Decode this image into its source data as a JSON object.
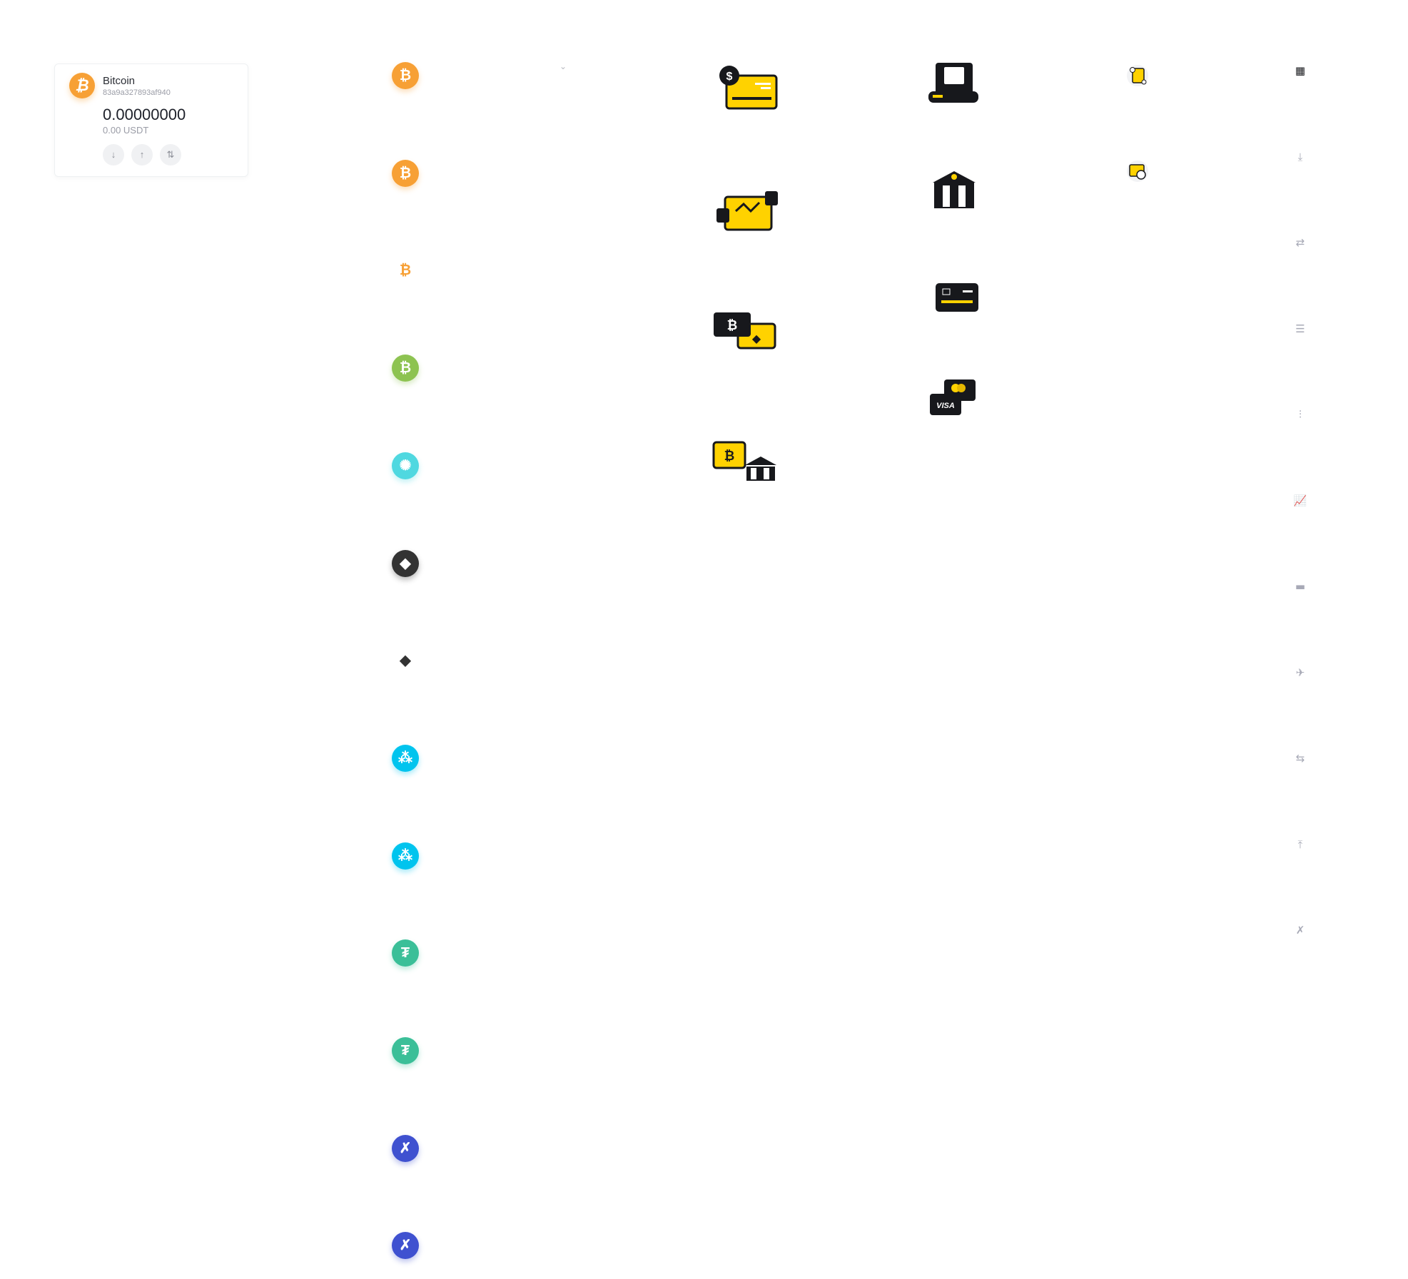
{
  "wallet_card": {
    "name": "Bitcoin",
    "address": "83a9a327893af940",
    "balance": "0.00000000",
    "fiat_value": "0.00 USDT",
    "actions": [
      "receive",
      "send",
      "exchange"
    ]
  },
  "coins": [
    {
      "icon": "bitcoin-icon",
      "color": "#f7a035",
      "glyph": "₿",
      "style": "circle"
    },
    {
      "icon": "bitcoin-icon",
      "color": "#f7a035",
      "glyph": "₿",
      "style": "circle"
    },
    {
      "icon": "bitcoin-icon",
      "color": "#f7a035",
      "glyph": "₿",
      "style": "plain"
    },
    {
      "icon": "bitcoin-cash-icon",
      "color": "#8dc351",
      "glyph": "₿",
      "style": "circle"
    },
    {
      "icon": "cardano-icon",
      "color": "#4fd8e0",
      "glyph": "✺",
      "style": "circle"
    },
    {
      "icon": "ethereum-icon",
      "color": "#333333",
      "glyph": "◆",
      "style": "circle"
    },
    {
      "icon": "ethereum-icon",
      "color": "#333333",
      "glyph": "◆",
      "style": "plain"
    },
    {
      "icon": "ripple-icon",
      "color": "#00c4ee",
      "glyph": "⁂",
      "style": "circle"
    },
    {
      "icon": "ripple-icon",
      "color": "#00c4ee",
      "glyph": "⁂",
      "style": "circle"
    },
    {
      "icon": "tether-icon",
      "color": "#3bbf98",
      "glyph": "₮",
      "style": "circle"
    },
    {
      "icon": "tether-icon",
      "color": "#3bbf98",
      "glyph": "₮",
      "style": "circle"
    },
    {
      "icon": "stellar-icon",
      "color": "#3f51d0",
      "glyph": "✗",
      "style": "circle"
    },
    {
      "icon": "stellar-icon",
      "color": "#3f51d0",
      "glyph": "✗",
      "style": "circle"
    }
  ],
  "illustrations_col1": [
    "card-payment-illustration",
    "trading-chart-illustration",
    "crypto-exchange-illustration",
    "crypto-to-bank-illustration"
  ],
  "illustrations_col2": [
    "atm-illustration",
    "bank-illustration",
    "bank-card-illustration",
    "visa-mastercard-illustration"
  ],
  "small_illustrations": [
    "document-settings-illustration",
    "window-refresh-illustration"
  ],
  "nav_icons": [
    "dashboard-icon",
    "download-icon",
    "exchange-icon",
    "list-icon",
    "candlestick-icon",
    "line-chart-icon",
    "card-icon",
    "airplane-icon",
    "transfer-icon",
    "upload-icon",
    "stellar-outline-icon"
  ],
  "colors": {
    "accent_yellow": "#ffd200",
    "dark": "#17181c",
    "nav_gray": "#a7a9b6"
  }
}
